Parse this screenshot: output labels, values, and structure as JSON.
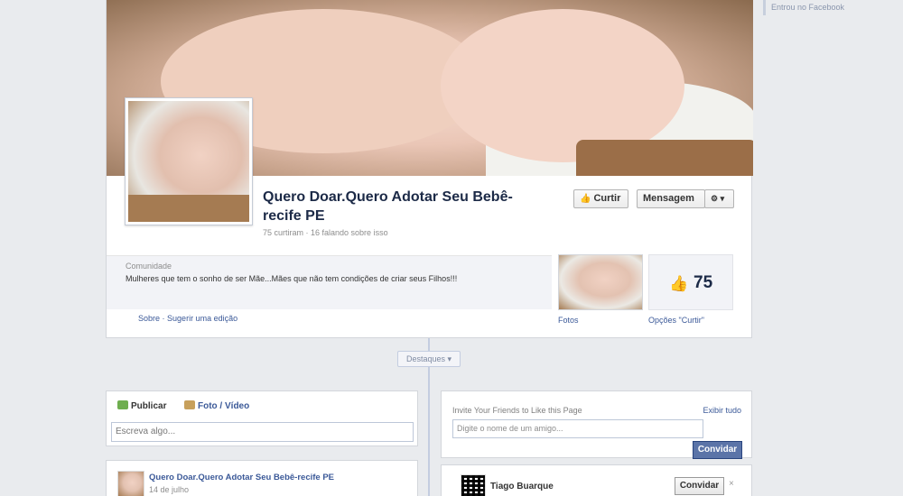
{
  "sidebar": {
    "hint": "Entrou no Facebook"
  },
  "page": {
    "title": "Quero Doar.Quero Adotar Seu Bebê-recife PE",
    "subtitle": "75 curtiram · 16 falando sobre isso",
    "like_button": "Curtir",
    "message_button": "Mensagem",
    "gear_button": "⚙ ▾"
  },
  "about": {
    "category": "Comunidade",
    "description": "Mulheres que tem o sonho de ser Mãe...Mães que não tem condições de criar seus Filhos!!!",
    "link_about": "Sobre",
    "link_suggest": "Sugerir uma edição"
  },
  "apps": {
    "photos_label": "Fotos",
    "likes_count": "75",
    "likes_label": "Opções \"Curtir\""
  },
  "timeline": {
    "destaques": "Destaques ▾"
  },
  "composer": {
    "tab_publish": "Publicar",
    "tab_photo": "Foto / Vídeo",
    "placeholder": "Escreva algo..."
  },
  "post": {
    "author": "Quero Doar.Quero Adotar Seu Bebê-recife PE",
    "date": "14 de julho"
  },
  "invite": {
    "header": "Invite Your Friends to Like this Page",
    "see_all": "Exibir tudo",
    "placeholder": "Digite o nome de um amigo...",
    "send_button": "Convidar"
  },
  "friend": {
    "name": "Tiago Buarque",
    "invite_button": "Convidar",
    "remove": "×"
  }
}
